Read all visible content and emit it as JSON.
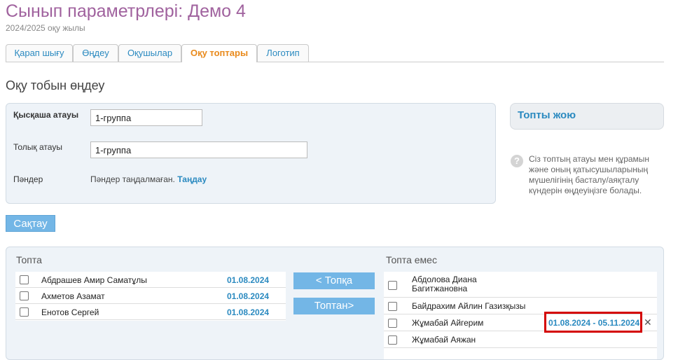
{
  "page": {
    "title": "Сынып параметрлері: Демо 4",
    "subtitle": "2024/2025 оқу жылы"
  },
  "tabs": [
    {
      "label": "Қарап шығу",
      "active": false
    },
    {
      "label": "Өңдеу",
      "active": false
    },
    {
      "label": "Оқушылар",
      "active": false
    },
    {
      "label": "Оқу топтары",
      "active": true
    },
    {
      "label": "Логотип",
      "active": false
    }
  ],
  "section_title": "Оқу тобын өңдеу",
  "form": {
    "short_name_label": "Қысқаша атауы",
    "short_name_value": "1-группа",
    "full_name_label": "Толық атауы",
    "full_name_value": "1-группа",
    "subjects_label": "Пәндер",
    "subjects_text": "Пәндер таңдалмаған.",
    "subjects_link": "Таңдау"
  },
  "side": {
    "delete_label": "Топты жою",
    "help_icon": "?",
    "help_text": "Сіз топтың атауы мен құрамын және оның қатысушыларының мүшелігінің басталу/аяқталу күндерін өңдеуіңізге болады."
  },
  "save_label": "Сақтау",
  "in_group": {
    "title": "Топта",
    "rows": [
      {
        "name": "Абдрашев Амир Саматұлы",
        "date": "01.08.2024"
      },
      {
        "name": "Ахметов Азамат",
        "date": "01.08.2024"
      },
      {
        "name": "Енотов Сергей",
        "date": "01.08.2024"
      }
    ]
  },
  "buttons": {
    "to_group": "< Топқа",
    "from_group": "Топтан>"
  },
  "not_in_group": {
    "title": "Топта емес",
    "rows": [
      {
        "name_line1": "Абдолова Диана",
        "name_line2": "Багитжановна"
      },
      {
        "name_line1": "Байдрахим Айлин Газизқызы",
        "name_line2": ""
      },
      {
        "name_line1": "Жұмабай Айгерим",
        "name_line2": "",
        "range": "01.08.2024 - 05.11.2024"
      },
      {
        "name_line1": "Жұмабай Аяжан",
        "name_line2": ""
      }
    ]
  },
  "colors": {
    "title": "#a0629e",
    "link": "#2b8ac0",
    "active_tab": "#e98a1c",
    "button": "#73b6e6",
    "highlight": "#d40000"
  }
}
